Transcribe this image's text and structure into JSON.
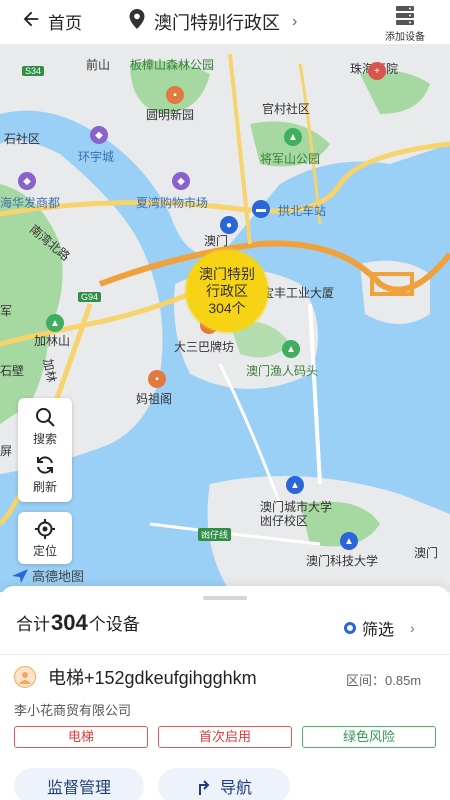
{
  "header": {
    "back_label": "首页",
    "region_title": "澳门特别行政区",
    "add_device_label": "添加设备",
    "icons": {
      "back": "arrow-left-icon",
      "pin": "location-pin-icon",
      "chevron": "chevron-right-icon",
      "server": "server-icon"
    }
  },
  "map": {
    "labels": [
      "前山",
      "板樟山森林公园",
      "珠海医院",
      "石社区",
      "圆明新园",
      "官村社区",
      "环宇城",
      "将军山公园",
      "海华发商都",
      "夏湾购物市场",
      "拱北车站",
      "南湾北路",
      "澳门",
      "宝丰工业大厦",
      "军",
      "加林山",
      "大三巴牌坊",
      "澳门渔人码头",
      "石壁",
      "妈祖阁",
      "屏",
      "澳门城市大学凼仔校区",
      "凼仔线",
      "澳门",
      "澳门科技大学",
      "加林",
      "S34",
      "G94"
    ],
    "cluster": {
      "name_line1": "澳门特别",
      "name_line2": "行政区",
      "count": "304个"
    },
    "tools": {
      "search_label": "搜索",
      "refresh_label": "刷新",
      "locate_label": "定位"
    },
    "logo_text": "高德地图",
    "colors": {
      "water": "#9ad0f5",
      "green": "#a6d9a1",
      "road_yellow": "#f6d36b",
      "road_orange": "#f0a13b",
      "land": "#e9eaec"
    }
  },
  "summary": {
    "prefix": "合计",
    "count": "304",
    "suffix": "个设备",
    "filter_label": "筛选"
  },
  "device": {
    "name": "电梯+152gdkeufgihgghkm",
    "distance": "区间：0.85m",
    "company": "李小花商贸有限公司",
    "tags": [
      {
        "label": "电梯",
        "color": "#e03b3b"
      },
      {
        "label": "首次启用",
        "color": "#e03b3b"
      },
      {
        "label": "绿色风险",
        "color": "#2e9a4f"
      }
    ]
  },
  "actions": {
    "supervise_label": "监督管理",
    "navigate_label": "导航"
  }
}
